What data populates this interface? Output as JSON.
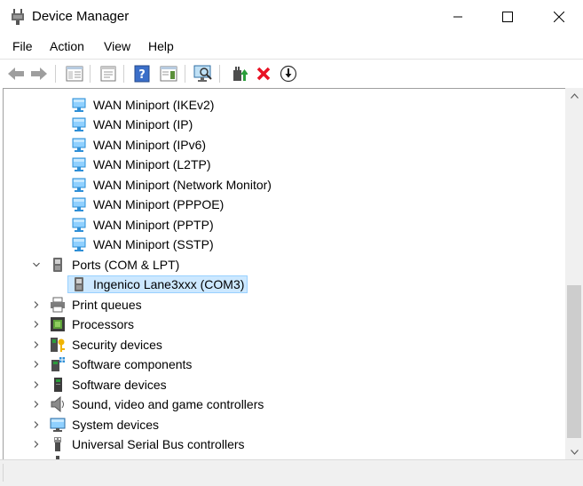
{
  "window": {
    "title": "Device Manager",
    "controls": [
      "minimize",
      "maximize",
      "close"
    ]
  },
  "menu": {
    "items": [
      "File",
      "Action",
      "View",
      "Help"
    ]
  },
  "toolbar": {
    "buttons": [
      "back-icon",
      "forward-icon",
      "show-hide-console-tree-icon",
      "properties-icon",
      "help-icon",
      "action-pane-icon",
      "scan-hardware-icon",
      "update-driver-icon",
      "uninstall-icon",
      "disable-device-icon"
    ]
  },
  "tree": {
    "wan_items": [
      "WAN Miniport (IKEv2)",
      "WAN Miniport (IP)",
      "WAN Miniport (IPv6)",
      "WAN Miniport (L2TP)",
      "WAN Miniport (Network Monitor)",
      "WAN Miniport (PPPOE)",
      "WAN Miniport (PPTP)",
      "WAN Miniport (SSTP)"
    ],
    "ports": {
      "label": "Ports (COM & LPT)",
      "expanded": true,
      "child": "Ingenico Lane3xxx (COM3)",
      "child_selected": true
    },
    "categories": [
      {
        "label": "Print queues",
        "icon": "printer-icon"
      },
      {
        "label": "Processors",
        "icon": "processor-icon"
      },
      {
        "label": "Security devices",
        "icon": "security-device-icon"
      },
      {
        "label": "Software components",
        "icon": "software-component-icon"
      },
      {
        "label": "Software devices",
        "icon": "software-device-icon"
      },
      {
        "label": "Sound, video and game controllers",
        "icon": "speaker-icon"
      },
      {
        "label": "System devices",
        "icon": "system-device-icon"
      },
      {
        "label": "Universal Serial Bus controllers",
        "icon": "usb-icon"
      }
    ]
  },
  "colors": {
    "selection_bg": "#cce8ff",
    "selection_border": "#99d1ff",
    "uninstall_red": "#e81123",
    "network_blue": "#2f8fd6"
  }
}
